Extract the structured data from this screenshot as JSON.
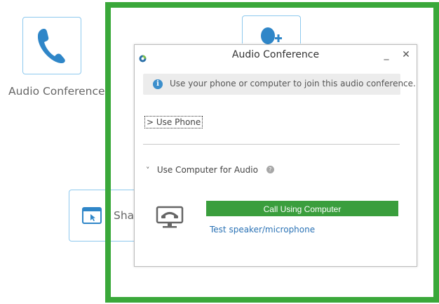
{
  "background": {
    "audio_tile": {
      "label": "Audio Conference",
      "icon": "phone-icon"
    },
    "add_user_tile": {
      "icon": "add-user-icon"
    },
    "share_tile": {
      "label": "Sha",
      "icon": "share-window-icon"
    }
  },
  "highlight": {
    "color": "#3aa83a"
  },
  "dialog": {
    "title": "Audio Conference",
    "minimize_label": "_",
    "close_label": "✕",
    "info": {
      "icon_glyph": "i",
      "text": "Use your phone or computer to join this audio conference."
    },
    "use_phone": {
      "chevron": ">",
      "label": "Use Phone"
    },
    "use_computer": {
      "chevron": "˅",
      "label": "Use Computer for Audio",
      "help_glyph": "?"
    },
    "call_button_label": "Call Using Computer",
    "test_link_label": "Test speaker/microphone",
    "colors": {
      "call_button": "#3a9e3d",
      "link": "#2a72b5",
      "info_icon": "#3c8fcc"
    }
  }
}
